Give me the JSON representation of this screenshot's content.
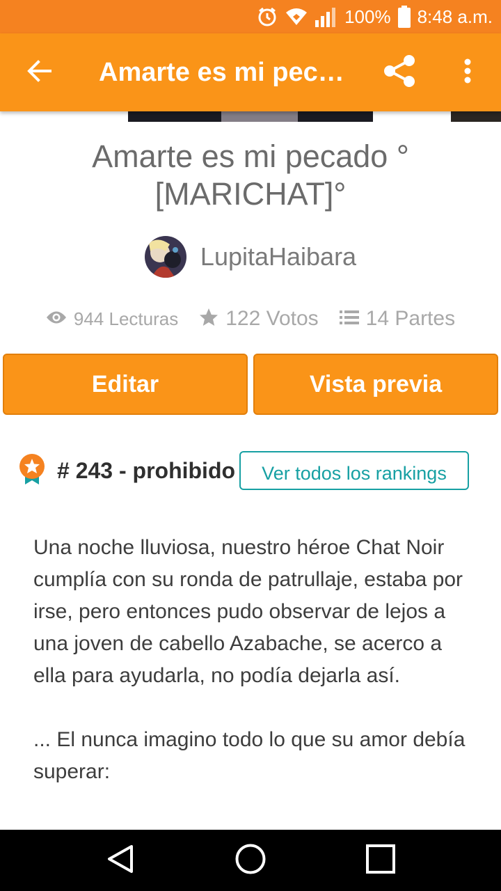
{
  "status_bar": {
    "battery": "100%",
    "time": "8:48 a.m.",
    "background_color": "#f58220"
  },
  "app_bar": {
    "title": "Amarte es mi pec…",
    "background_color": "#fa9418",
    "icons": [
      "back-arrow-icon",
      "share-icon",
      "more-vertical-icon"
    ]
  },
  "story": {
    "title": "Amarte es mi pecado ° [MARICHAT]°",
    "author": "LupitaHaibara"
  },
  "stats": {
    "reads": "944 Lecturas",
    "votes": "122 Votos",
    "parts": "14 Partes"
  },
  "actions": {
    "edit_label": "Editar",
    "preview_label": "Vista previa",
    "accent_color": "#fa9418"
  },
  "ranking": {
    "text": "# 243 - prohibido",
    "button_label": "Ver todos los rankings",
    "button_color": "#17a0a3"
  },
  "description": {
    "paragraph_1": "Una noche lluviosa, nuestro héroe Chat Noir cumplía con su ronda de patrullaje, estaba por irse, pero entonces pudo observar de lejos a una joven de cabello Azabache, se acerco a ella para ayudarla, no podía dejarla así.",
    "paragraph_2": "... El nunca imagino todo lo que su amor debía superar:"
  },
  "nav_bar": {
    "icons": [
      "nav-back-icon",
      "nav-home-icon",
      "nav-recents-icon"
    ]
  }
}
